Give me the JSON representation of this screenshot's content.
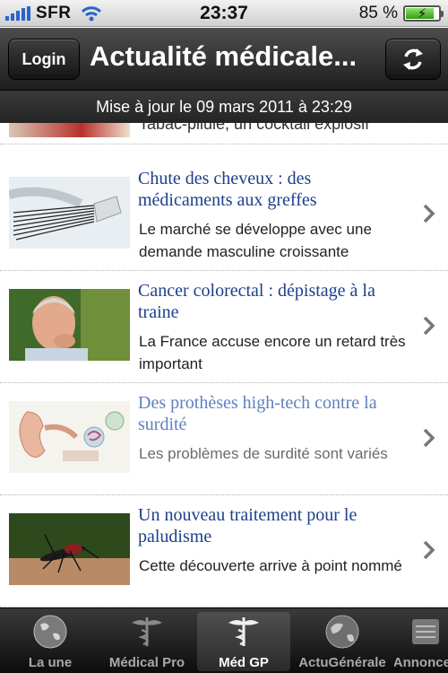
{
  "status_bar": {
    "carrier": "SFR",
    "time": "23:37",
    "battery": "85 %",
    "battery_level": 0.85
  },
  "navbar": {
    "login_label": "Login",
    "title": "Actualité médicale...",
    "refresh_icon": "refresh-icon"
  },
  "update_text": "Mise à jour le 09 mars 2011 à 23:29",
  "list": {
    "partial_item_title": "Tabac-pilule, un cocktail explosif",
    "items": [
      {
        "title": "Chute des cheveux : des médicaments aux greffes",
        "description": "Le marché se développe avec une demande masculine croissante"
      },
      {
        "title": "Cancer colorectal : dépistage à la traine",
        "description": "La France accuse encore un retard très important"
      },
      {
        "title": "Des prothèses high-tech contre la surdité",
        "description": "Les problèmes de surdité sont variés"
      },
      {
        "title": "Un nouveau traitement pour le paludisme",
        "description": "Cette découverte arrive à point nommé"
      }
    ]
  },
  "tabs": [
    {
      "label": "La une",
      "icon": "globe-icon"
    },
    {
      "label": "Médical Pro",
      "icon": "caduceus-icon"
    },
    {
      "label": "Méd GP",
      "icon": "caduceus-icon",
      "active": true
    },
    {
      "label": "ActuGénérale",
      "icon": "globe-icon"
    },
    {
      "label": "Annonces",
      "icon": "list-icon"
    }
  ],
  "colors": {
    "headline": "#1d3f8a",
    "headline_read": "#5f80bf",
    "bar_dark": "#1e1e1e",
    "signal": "#2a64c8"
  }
}
